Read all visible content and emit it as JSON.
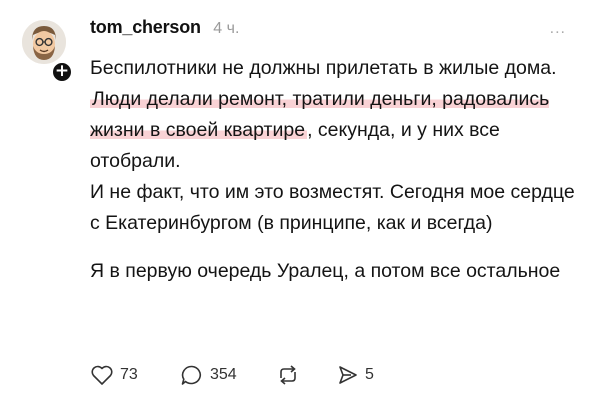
{
  "post": {
    "username": "tom_cherson",
    "time": "4 ч.",
    "more": "...",
    "lines": [
      {
        "pre": "Беспилотники не должны прилетать в жилые дома. ",
        "highlight": "Люди делали ремонт, тратили деньги, радовались жизни в своей квартире",
        "post": ", секунда, и у них все отобрали."
      },
      {
        "pre": "И не факт, что им это возместят. Сегодня мое сердце с Екатеринбургом (в принципе, как и всегда)",
        "highlight": "",
        "post": ""
      },
      {
        "pre": "Я в первую очередь Уралец, а потом все остальное",
        "highlight": "",
        "post": ""
      }
    ],
    "actions": {
      "likes": "73",
      "replies": "354",
      "shares": "5"
    },
    "colors": {
      "highlight": "#ec7680",
      "muted": "#9b9b9b",
      "text": "#141414"
    },
    "icons": {
      "like": "heart-icon",
      "reply": "comment-icon",
      "repost": "repost-icon",
      "share": "send-icon",
      "follow": "plus-icon"
    }
  }
}
